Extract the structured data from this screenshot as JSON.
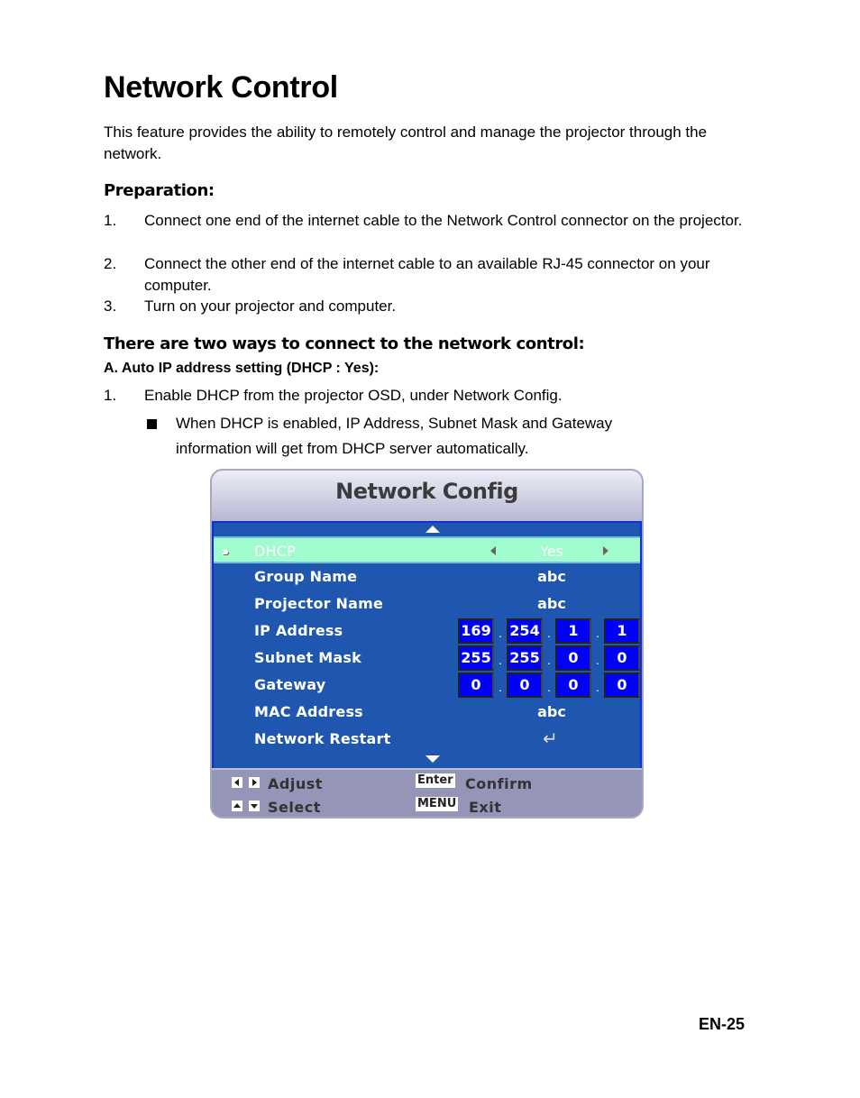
{
  "page": {
    "title": "Network Control",
    "intro": "This feature provides the ability to remotely control and manage the projector through the network.",
    "preparation": {
      "heading": "Preparation:",
      "steps": [
        {
          "num": "1.",
          "text": "Connect one end of the internet cable to the Network Control connector on the projector."
        },
        {
          "num": "2.",
          "text": "Connect the other end of the internet cable to an available RJ-45 connector on your computer."
        },
        {
          "num": "3.",
          "text": "Turn on your projector and computer."
        }
      ]
    },
    "ways": {
      "heading": "There are two ways to connect to the network control:",
      "subheading": "A. Auto IP address setting (DHCP : Yes):",
      "steps": [
        {
          "num": "1.",
          "text": "Enable DHCP from the projector OSD, under Network Config."
        }
      ],
      "bullet": "When DHCP is enabled, IP Address, Subnet Mask and Gateway information will get from DHCP server automatically."
    },
    "page_number": "EN-25"
  },
  "osd": {
    "title": "Network Config",
    "rows": [
      {
        "label": "DHCP",
        "value": "Yes",
        "selected": true
      },
      {
        "label": "Group Name",
        "value": "abc"
      },
      {
        "label": "Projector Name",
        "value": "abc"
      },
      {
        "label": "IP Address",
        "octets": [
          "169",
          "254",
          "1",
          "1"
        ]
      },
      {
        "label": "Subnet Mask",
        "octets": [
          "255",
          "255",
          "0",
          "0"
        ]
      },
      {
        "label": "Gateway",
        "octets": [
          "0",
          "0",
          "0",
          "0"
        ]
      },
      {
        "label": "MAC Address",
        "value": "abc"
      },
      {
        "label": "Network Restart",
        "icon": "enter-return-icon"
      }
    ],
    "footer": {
      "adjust": "Adjust",
      "select": "Select",
      "enter_key": "Enter",
      "confirm": "Confirm",
      "menu_key": "MENU",
      "exit": "Exit"
    },
    "colors": {
      "body": "#1e56b0",
      "selected_row": "#a0fccc",
      "ip_box": "#0000f8",
      "footer": "#9495b7"
    }
  }
}
